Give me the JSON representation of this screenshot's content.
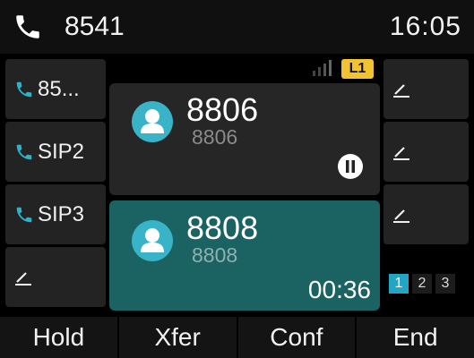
{
  "status": {
    "phone_icon": "phone-handset-icon",
    "account_number": "8541",
    "time": "16:05"
  },
  "left_keys": [
    {
      "label": "85...",
      "icon": "phone-handset-icon",
      "icon_color": "#2db3c9"
    },
    {
      "label": "SIP2",
      "icon": "phone-handset-icon",
      "icon_color": "#2db3c9"
    },
    {
      "label": "SIP3",
      "icon": "phone-handset-icon",
      "icon_color": "#2db3c9"
    },
    {
      "label": "",
      "icon": "pencil-icon"
    }
  ],
  "right_keys": [
    {
      "icon": "pencil-icon"
    },
    {
      "icon": "pencil-icon"
    },
    {
      "icon": "pencil-icon"
    }
  ],
  "line_badge": "L1",
  "calls": [
    {
      "number": "8806",
      "subtitle": "8806",
      "state": "held",
      "state_icon": "pause-circle-icon"
    },
    {
      "number": "8808",
      "subtitle": "8808",
      "state": "active",
      "duration": "00:36"
    }
  ],
  "pages": {
    "items": [
      "1",
      "2",
      "3"
    ],
    "current": "1"
  },
  "softkeys": [
    "Hold",
    "Xfer",
    "Conf",
    "End"
  ],
  "colors": {
    "accent": "#2db3c9",
    "active_call": "#1b6263",
    "held_call": "#262626",
    "line_badge": "#f2c230"
  }
}
